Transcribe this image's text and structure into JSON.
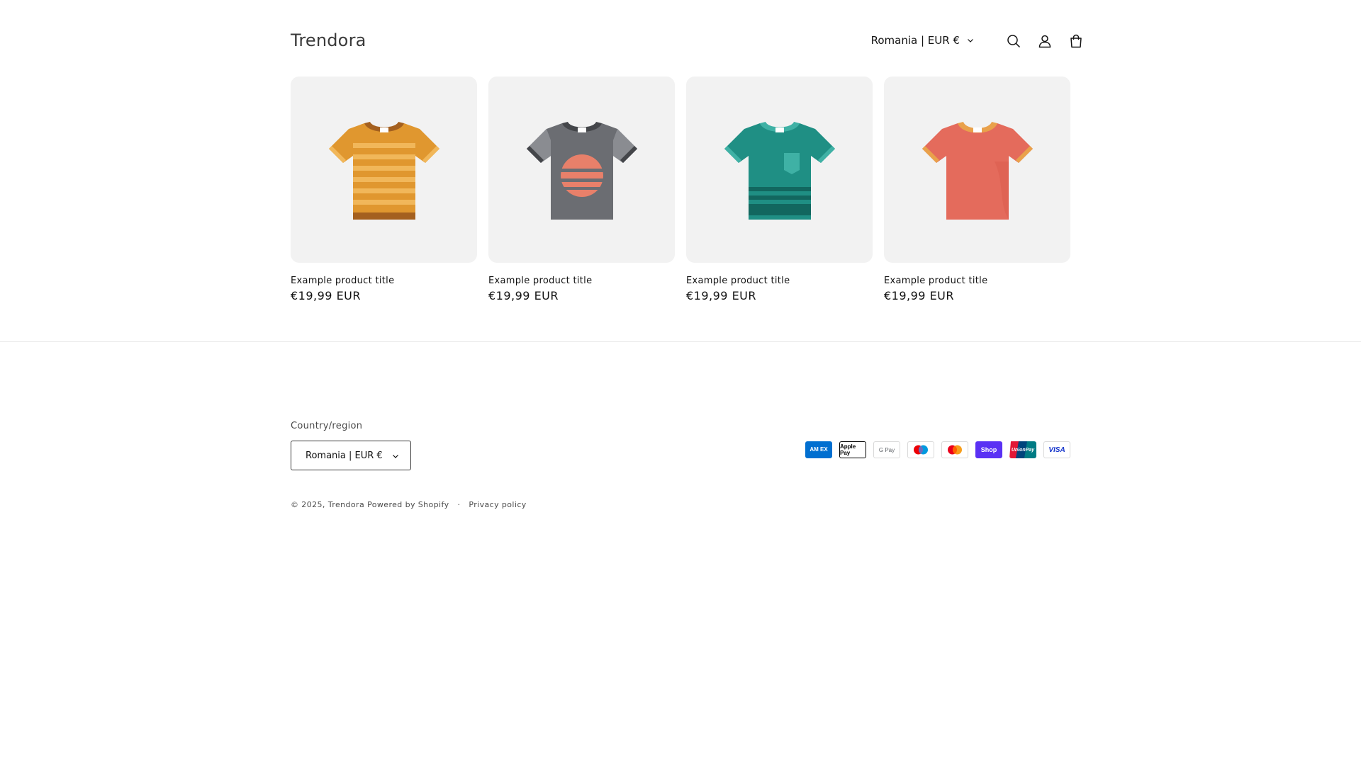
{
  "header": {
    "logo": "Trendora",
    "localization": "Romania | EUR €"
  },
  "products": [
    {
      "title": "Example product title",
      "price": "€19,99 EUR",
      "shirt_color": "#e0972f",
      "accent": "#f1b75a",
      "collar": "#a4601f"
    },
    {
      "title": "Example product title",
      "price": "€19,99 EUR",
      "shirt_color": "#6b6d72",
      "accent": "#8a8c91",
      "collar": "#44464a"
    },
    {
      "title": "Example product title",
      "price": "€19,99 EUR",
      "shirt_color": "#1f8f84",
      "accent": "#3fb1a5",
      "collar": "#12675f"
    },
    {
      "title": "Example product title",
      "price": "€19,99 EUR",
      "shirt_color": "#e46b5c",
      "accent": "#e9a14b",
      "collar": "#c9533f"
    }
  ],
  "footer": {
    "country_label": "Country/region",
    "country_value": "Romania | EUR €",
    "payments": [
      {
        "name": "American Express",
        "label": "AM EX",
        "bg": "#016fd0",
        "fg": "#ffffff"
      },
      {
        "name": "Apple Pay",
        "label": "Apple Pay",
        "bg": "#ffffff",
        "fg": "#000000"
      },
      {
        "name": "Google Pay",
        "label": "G Pay",
        "bg": "#ffffff",
        "fg": "#5f6368"
      },
      {
        "name": "Maestro",
        "label": "",
        "bg": "#ffffff",
        "fg": "#000000"
      },
      {
        "name": "Mastercard",
        "label": "",
        "bg": "#ffffff",
        "fg": "#000000"
      },
      {
        "name": "Shop Pay",
        "label": "Shop",
        "bg": "#5a31f4",
        "fg": "#ffffff"
      },
      {
        "name": "UnionPay",
        "label": "UnionPay",
        "bg": "#ffffff",
        "fg": "#ffffff"
      },
      {
        "name": "Visa",
        "label": "VISA",
        "bg": "#ffffff",
        "fg": "#1434cb"
      }
    ],
    "copyright_prefix": "© 2025,",
    "copyright_brand": "Trendora",
    "powered_by": "Powered by Shopify",
    "separator": "·",
    "privacy": "Privacy policy"
  }
}
